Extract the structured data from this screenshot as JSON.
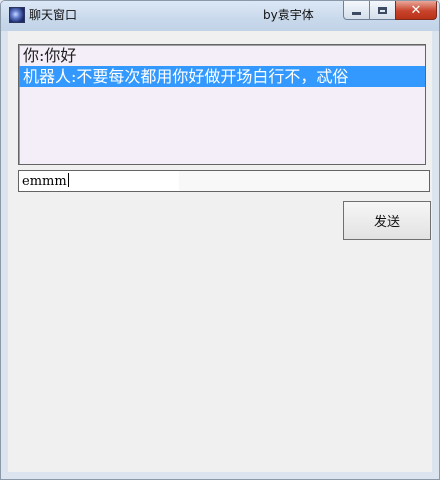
{
  "window": {
    "title": "聊天窗口",
    "subtitle": "by袁宇体"
  },
  "chat": {
    "messages": [
      {
        "text": "你:你好",
        "selected": false
      },
      {
        "text": "机器人:不要每次都用你好做开场白行不，忒俗",
        "selected": true
      }
    ]
  },
  "input": {
    "value": "emmm"
  },
  "send_button": {
    "label": "发送"
  },
  "colors": {
    "selection": "#3399ff",
    "chat_background": "#f4eef8",
    "close_button": "#c8432b"
  },
  "icons": [
    "app-icon",
    "minimize-icon",
    "maximize-icon",
    "close-icon"
  ]
}
